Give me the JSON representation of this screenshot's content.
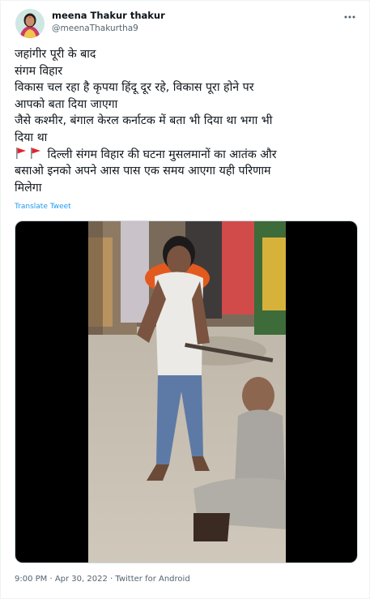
{
  "tweet": {
    "author": {
      "display_name": "meena Thakur thakur",
      "handle": "@meenaThakurtha9"
    },
    "text_lines": [
      "जहांगीर पूरी के बाद",
      "संगम विहार",
      "विकास चल रहा है कृपया हिंदू दूर रहे, विकास पूरा होने पर",
      "आपको बता दिया जाएगा",
      "जैसे कश्मीर, बंगाल केरल  कर्नाटक  में बता भी दिया था भगा भी",
      "दिया था",
      "दिल्ली संगम विहार की घटना मुसलमानों का आतंक और",
      "बसाओ इनको अपने आस पास एक समय आएगा यही परिणाम",
      "मिलेगा"
    ],
    "translate_label": "Translate Tweet",
    "timestamp": "9:00 PM · Apr 30, 2022 · Twitter for Android",
    "icons": {
      "more": "more-horizontal-icon",
      "flag": "red-flag-icon",
      "avatar": "profile-avatar"
    },
    "colors": {
      "link": "#1d9bf0",
      "secondary_text": "#536471",
      "primary_text": "#0f1419",
      "flag": "#e0242f"
    }
  }
}
